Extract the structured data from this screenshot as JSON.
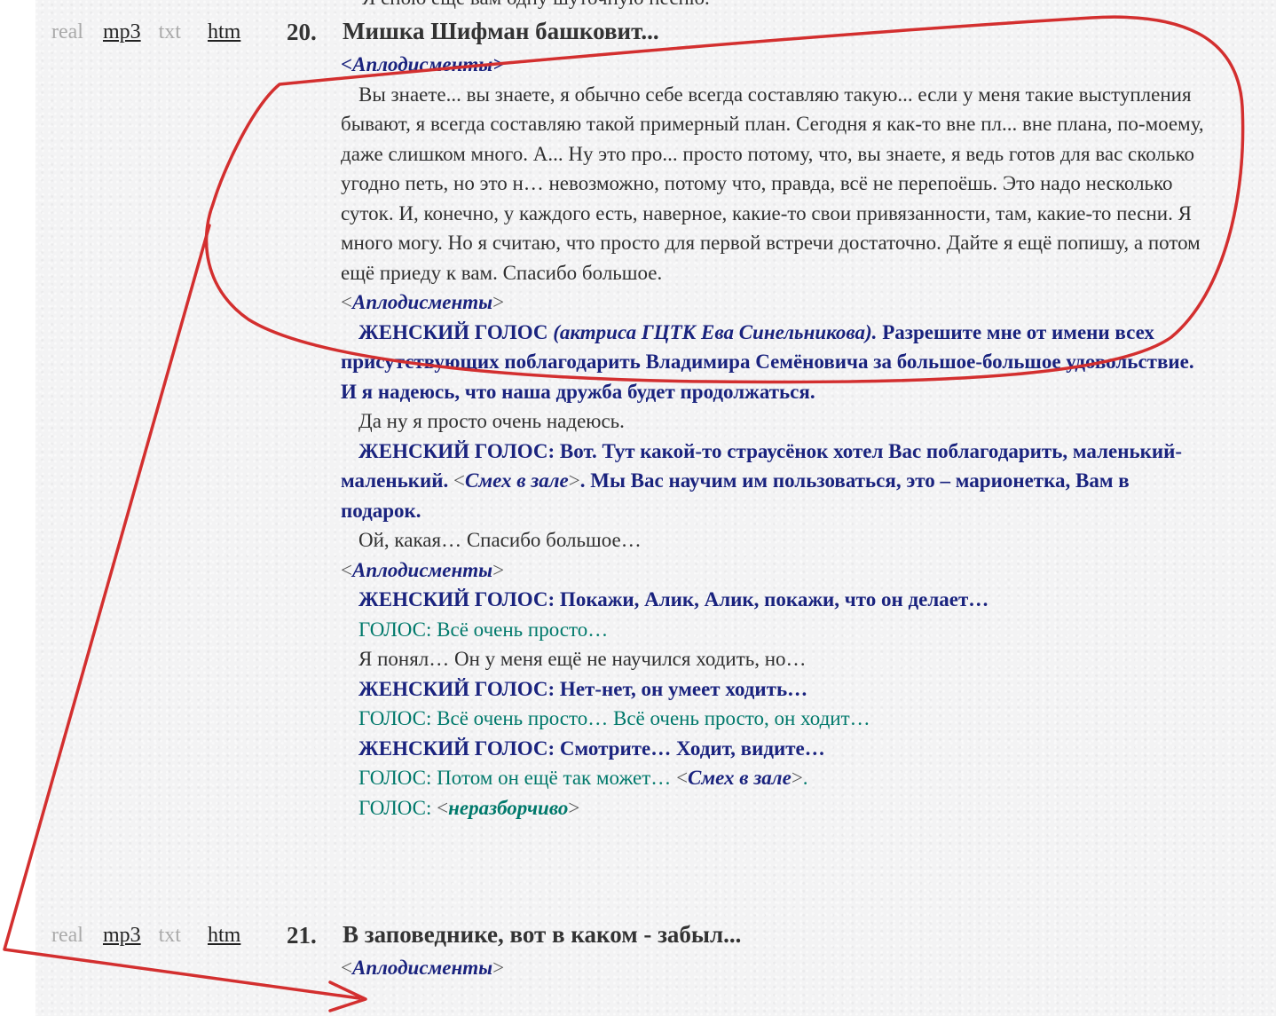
{
  "cutoff_line": "Я спою еще вам одну шуточную песню.",
  "items": [
    {
      "links": {
        "real": "real",
        "mp3": "mp3",
        "txt": "txt",
        "htm": "htm"
      },
      "number": "20.",
      "title": "Мишка Шифман башковит...",
      "ann_open": "<Аплодисменты>",
      "speech1": "Вы знаете... вы знаете, я обычно себе всегда составляю такую... если у меня такие выступления бывают, я всегда составляю такой примерный план. Сегодня я как-то вне пл... вне плана, по-моему, даже слишком много. А... Ну это про... просто потому, что, вы знаете, я ведь готов для вас сколько угодно петь, но это н… невозможно, потому что, правда, всё не перепоёшь. Это надо несколько суток. И, конечно, у каждого есть, наверное, какие-то свои привязанности, там, какие-то песни. Я много могу. Но я считаю, что просто для первой встречи достаточно. Дайте я ещё попишу, а потом ещё приеду к вам. Спасибо большое.",
      "ann2": "Аплодисменты",
      "female1_label": "ЖЕНСКИЙ ГОЛОС",
      "female1_role": "(актриса ГЦТК Ева Синельникова).",
      "female1_text": "Разрешите мне от имени всех присутствующих поблагодарить Владимира Семёновича за большое-большое удовольствие. И я надеюсь, что наша дружба будет продолжаться.",
      "speech2": "Да ну я просто очень надеюсь.",
      "female2_a": "ЖЕНСКИЙ ГОЛОС: Вот. Тут какой-то страусёнок хотел Вас поблагодарить, маленький-маленький.",
      "female2_ann": "Смех в зале",
      "female2_b": ". Мы Вас научим им пользоваться, это – марионетка, Вам в подарок.",
      "speech3": "Ой, какая…  Спасибо большое…",
      "ann3": "Аплодисменты",
      "female3": "ЖЕНСКИЙ ГОЛОС: Покажи, Алик, Алик, покажи, что он делает…",
      "voice1": "ГОЛОС: Всё очень просто…",
      "speech4": "Я понял…  Он у меня ещё не научился ходить, но…",
      "female4": "ЖЕНСКИЙ ГОЛОС: Нет-нет, он умеет ходить…",
      "voice2": "ГОЛОС: Всё очень просто…  Всё очень просто, он ходит…",
      "female5": "ЖЕНСКИЙ ГОЛОС: Смотрите…  Ходит, видите…",
      "voice3_a": "ГОЛОС: Потом он ещё так может…",
      "voice3_ann": "Смех в зале",
      "voice3_b": ".",
      "voice4_a": "ГОЛОС:",
      "voice4_ann": "неразборчиво"
    },
    {
      "links": {
        "real": "real",
        "mp3": "mp3",
        "txt": "txt",
        "htm": "htm"
      },
      "number": "21.",
      "title": "В заповеднике, вот в каком - забыл...",
      "ann_open": "Аплодисменты"
    }
  ],
  "colors": {
    "paper": "#f3f3f4",
    "female_voice": "#1a237e",
    "voice": "#00796b",
    "speaker": "#303030",
    "annotation_stroke": "#d32f2f"
  }
}
